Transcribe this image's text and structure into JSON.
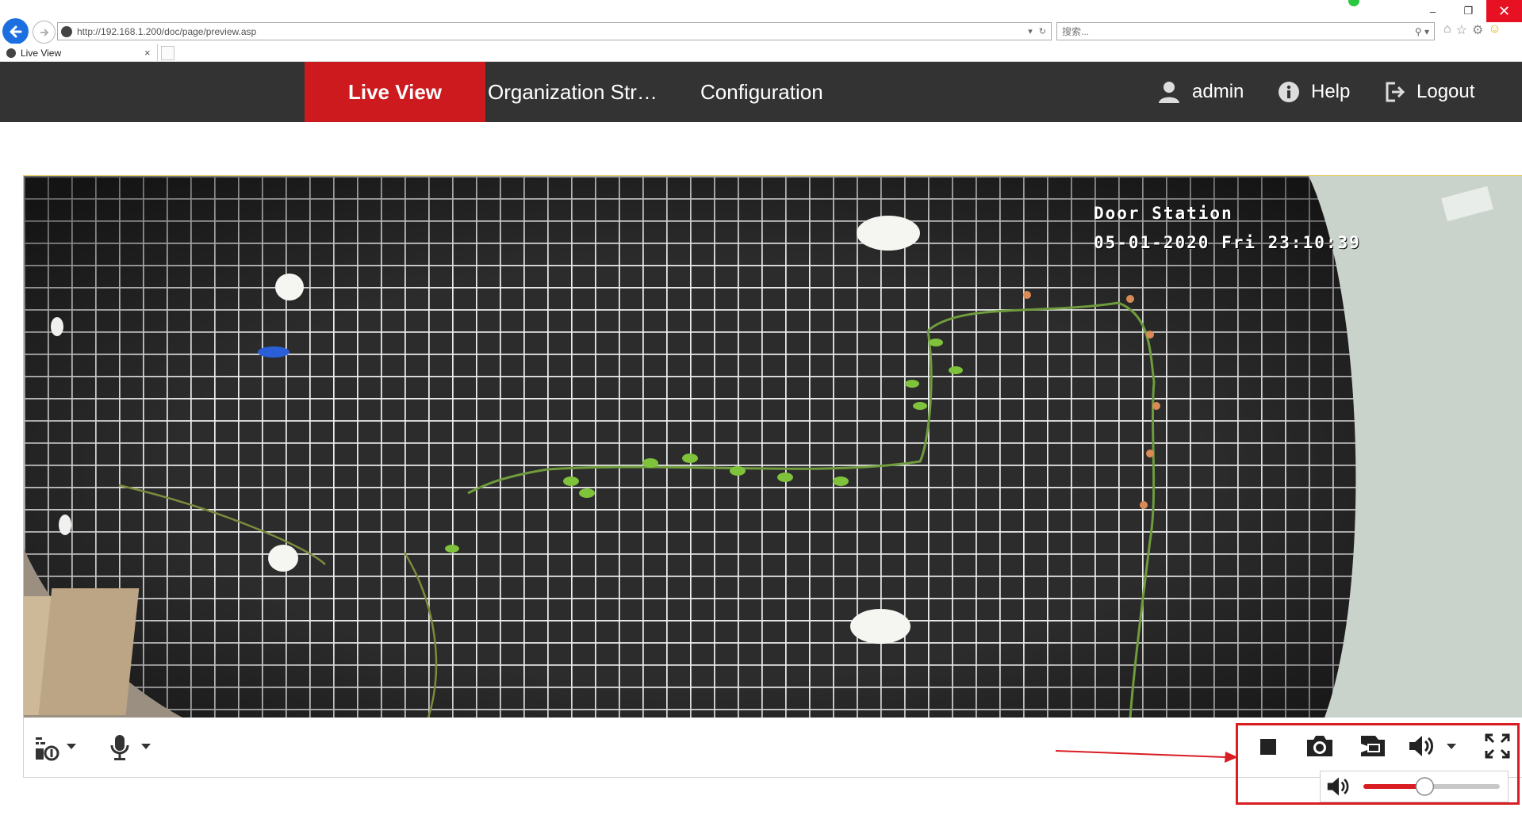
{
  "browser": {
    "url": "http://192.168.1.200/doc/page/preview.asp",
    "search_placeholder": "搜索...",
    "tab_title": "Live View",
    "tab_close": "×",
    "window_controls": {
      "minimize": "–",
      "restore": "❐",
      "close": "✕"
    }
  },
  "header": {
    "nav": {
      "live_view": "Live View",
      "organization": "Organization Str…",
      "configuration": "Configuration"
    },
    "user": "admin",
    "help": "Help",
    "logout": "Logout",
    "colors": {
      "bar": "#333333",
      "active": "#cc1a1e"
    }
  },
  "video": {
    "osd_title": "Door Station",
    "osd_timestamp": "05-01-2020 Fri 23:10:39"
  },
  "controls": {
    "left": [
      "window-split-icon",
      "microphone-icon"
    ],
    "right": [
      "stop-icon",
      "capture-icon",
      "record-icon",
      "volume-icon",
      "fullscreen-icon"
    ],
    "volume_level": 0.45
  },
  "annotation": {
    "color": "#d81d23"
  }
}
